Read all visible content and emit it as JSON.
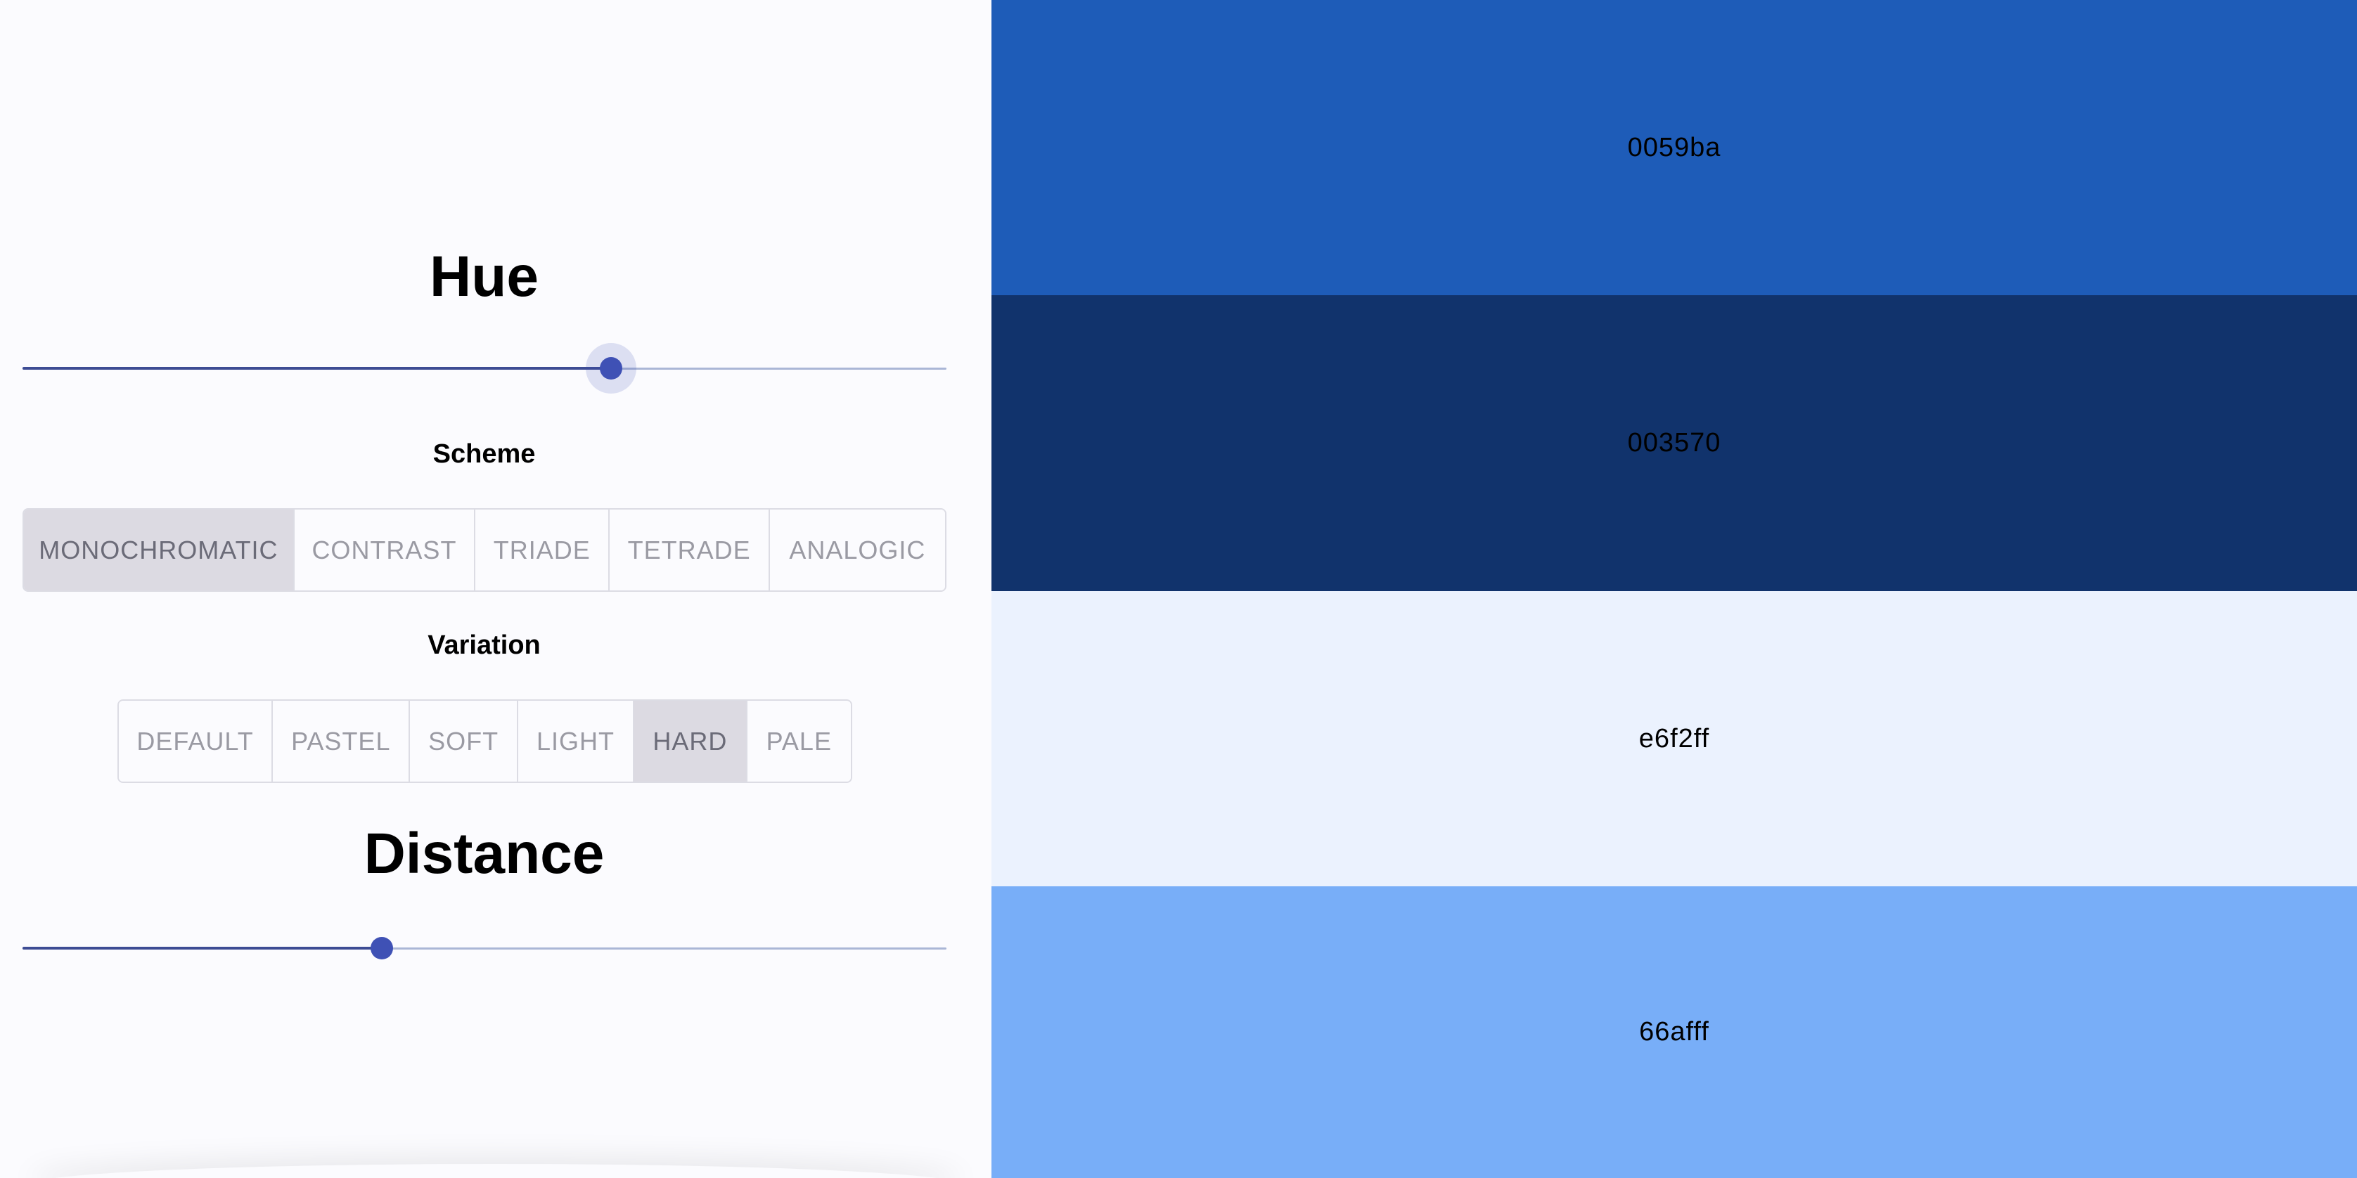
{
  "hue": {
    "title": "Hue",
    "value_fraction": 0.637
  },
  "scheme": {
    "title": "Scheme",
    "options": [
      "MONOCHROMATIC",
      "CONTRAST",
      "TRIADE",
      "TETRADE",
      "ANALOGIC"
    ],
    "selected": "MONOCHROMATIC"
  },
  "variation": {
    "title": "Variation",
    "options": [
      "DEFAULT",
      "PASTEL",
      "SOFT",
      "LIGHT",
      "HARD",
      "PALE"
    ],
    "selected": "HARD"
  },
  "distance": {
    "title": "Distance",
    "value_fraction": 0.389
  },
  "swatches": [
    {
      "label": "0059ba",
      "color": "#1e5cb8"
    },
    {
      "label": "003570",
      "color": "#11336c"
    },
    {
      "label": "e6f2ff",
      "color": "#ebf2fe"
    },
    {
      "label": "66afff",
      "color": "#78aef8"
    }
  ],
  "colors": {
    "slider_thumb": "#3f51b5",
    "slider_track": "#3d4c94",
    "slider_rail": "#aab6d6",
    "toggle_selected_bg": "#dcdae2"
  }
}
